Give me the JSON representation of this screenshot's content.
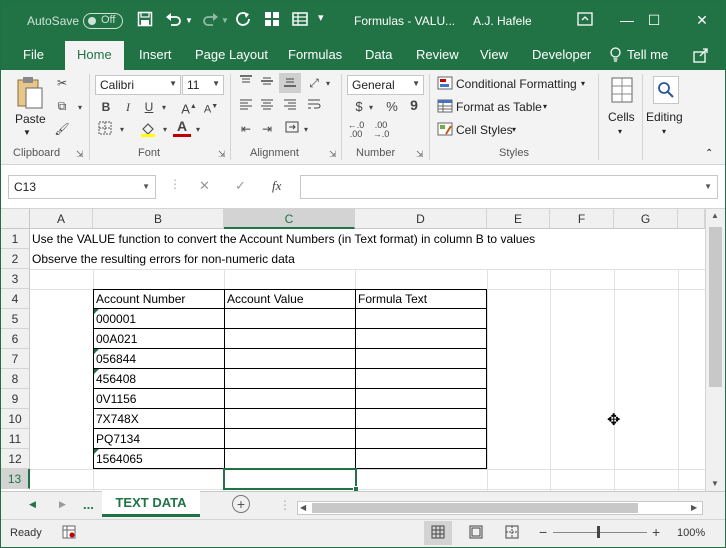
{
  "titlebar": {
    "autosave_label": "AutoSave",
    "autosave_state": "Off",
    "title": "Formulas - VALU...",
    "user": "A.J. Hafele"
  },
  "ribbon_tabs": [
    "File",
    "Home",
    "Insert",
    "Page Layout",
    "Formulas",
    "Data",
    "Review",
    "View",
    "Developer",
    "Tell me"
  ],
  "active_tab": "Home",
  "ribbon": {
    "paste_label": "Paste",
    "font_name": "Calibri",
    "font_size": "11",
    "number_format": "General",
    "conditional_formatting": "Conditional Formatting",
    "format_as_table": "Format as Table",
    "cell_styles": "Cell Styles",
    "cells_label": "Cells",
    "editing_label": "Editing",
    "groups": {
      "clipboard": "Clipboard",
      "font": "Font",
      "alignment": "Alignment",
      "number": "Number",
      "styles": "Styles"
    },
    "bold": "B",
    "italic": "I",
    "underline": "U",
    "currency": "$",
    "percent": "%",
    "comma": "9"
  },
  "formula_bar": {
    "name_box": "C13",
    "fx": "fx",
    "formula": ""
  },
  "columns": [
    "A",
    "B",
    "C",
    "D",
    "E",
    "F",
    "G"
  ],
  "rows": [
    "1",
    "2",
    "3",
    "4",
    "5",
    "6",
    "7",
    "8",
    "9",
    "10",
    "11",
    "12",
    "13"
  ],
  "cells": {
    "A1": "Use the VALUE function to convert the Account Numbers (in Text format) in column B to values",
    "A2": "Observe the resulting errors for non-numeric data"
  },
  "table": {
    "headers": [
      "Account Number",
      "Account Value",
      "Formula Text"
    ],
    "account_numbers": [
      "000001",
      "00A021",
      "056844",
      "456408",
      "0V1156",
      "7X748X",
      "PQ7134",
      "1564065"
    ]
  },
  "sheet_tab": "TEXT DATA",
  "sheet_nav_more": "...",
  "status": {
    "ready": "Ready",
    "zoom": "100%"
  }
}
